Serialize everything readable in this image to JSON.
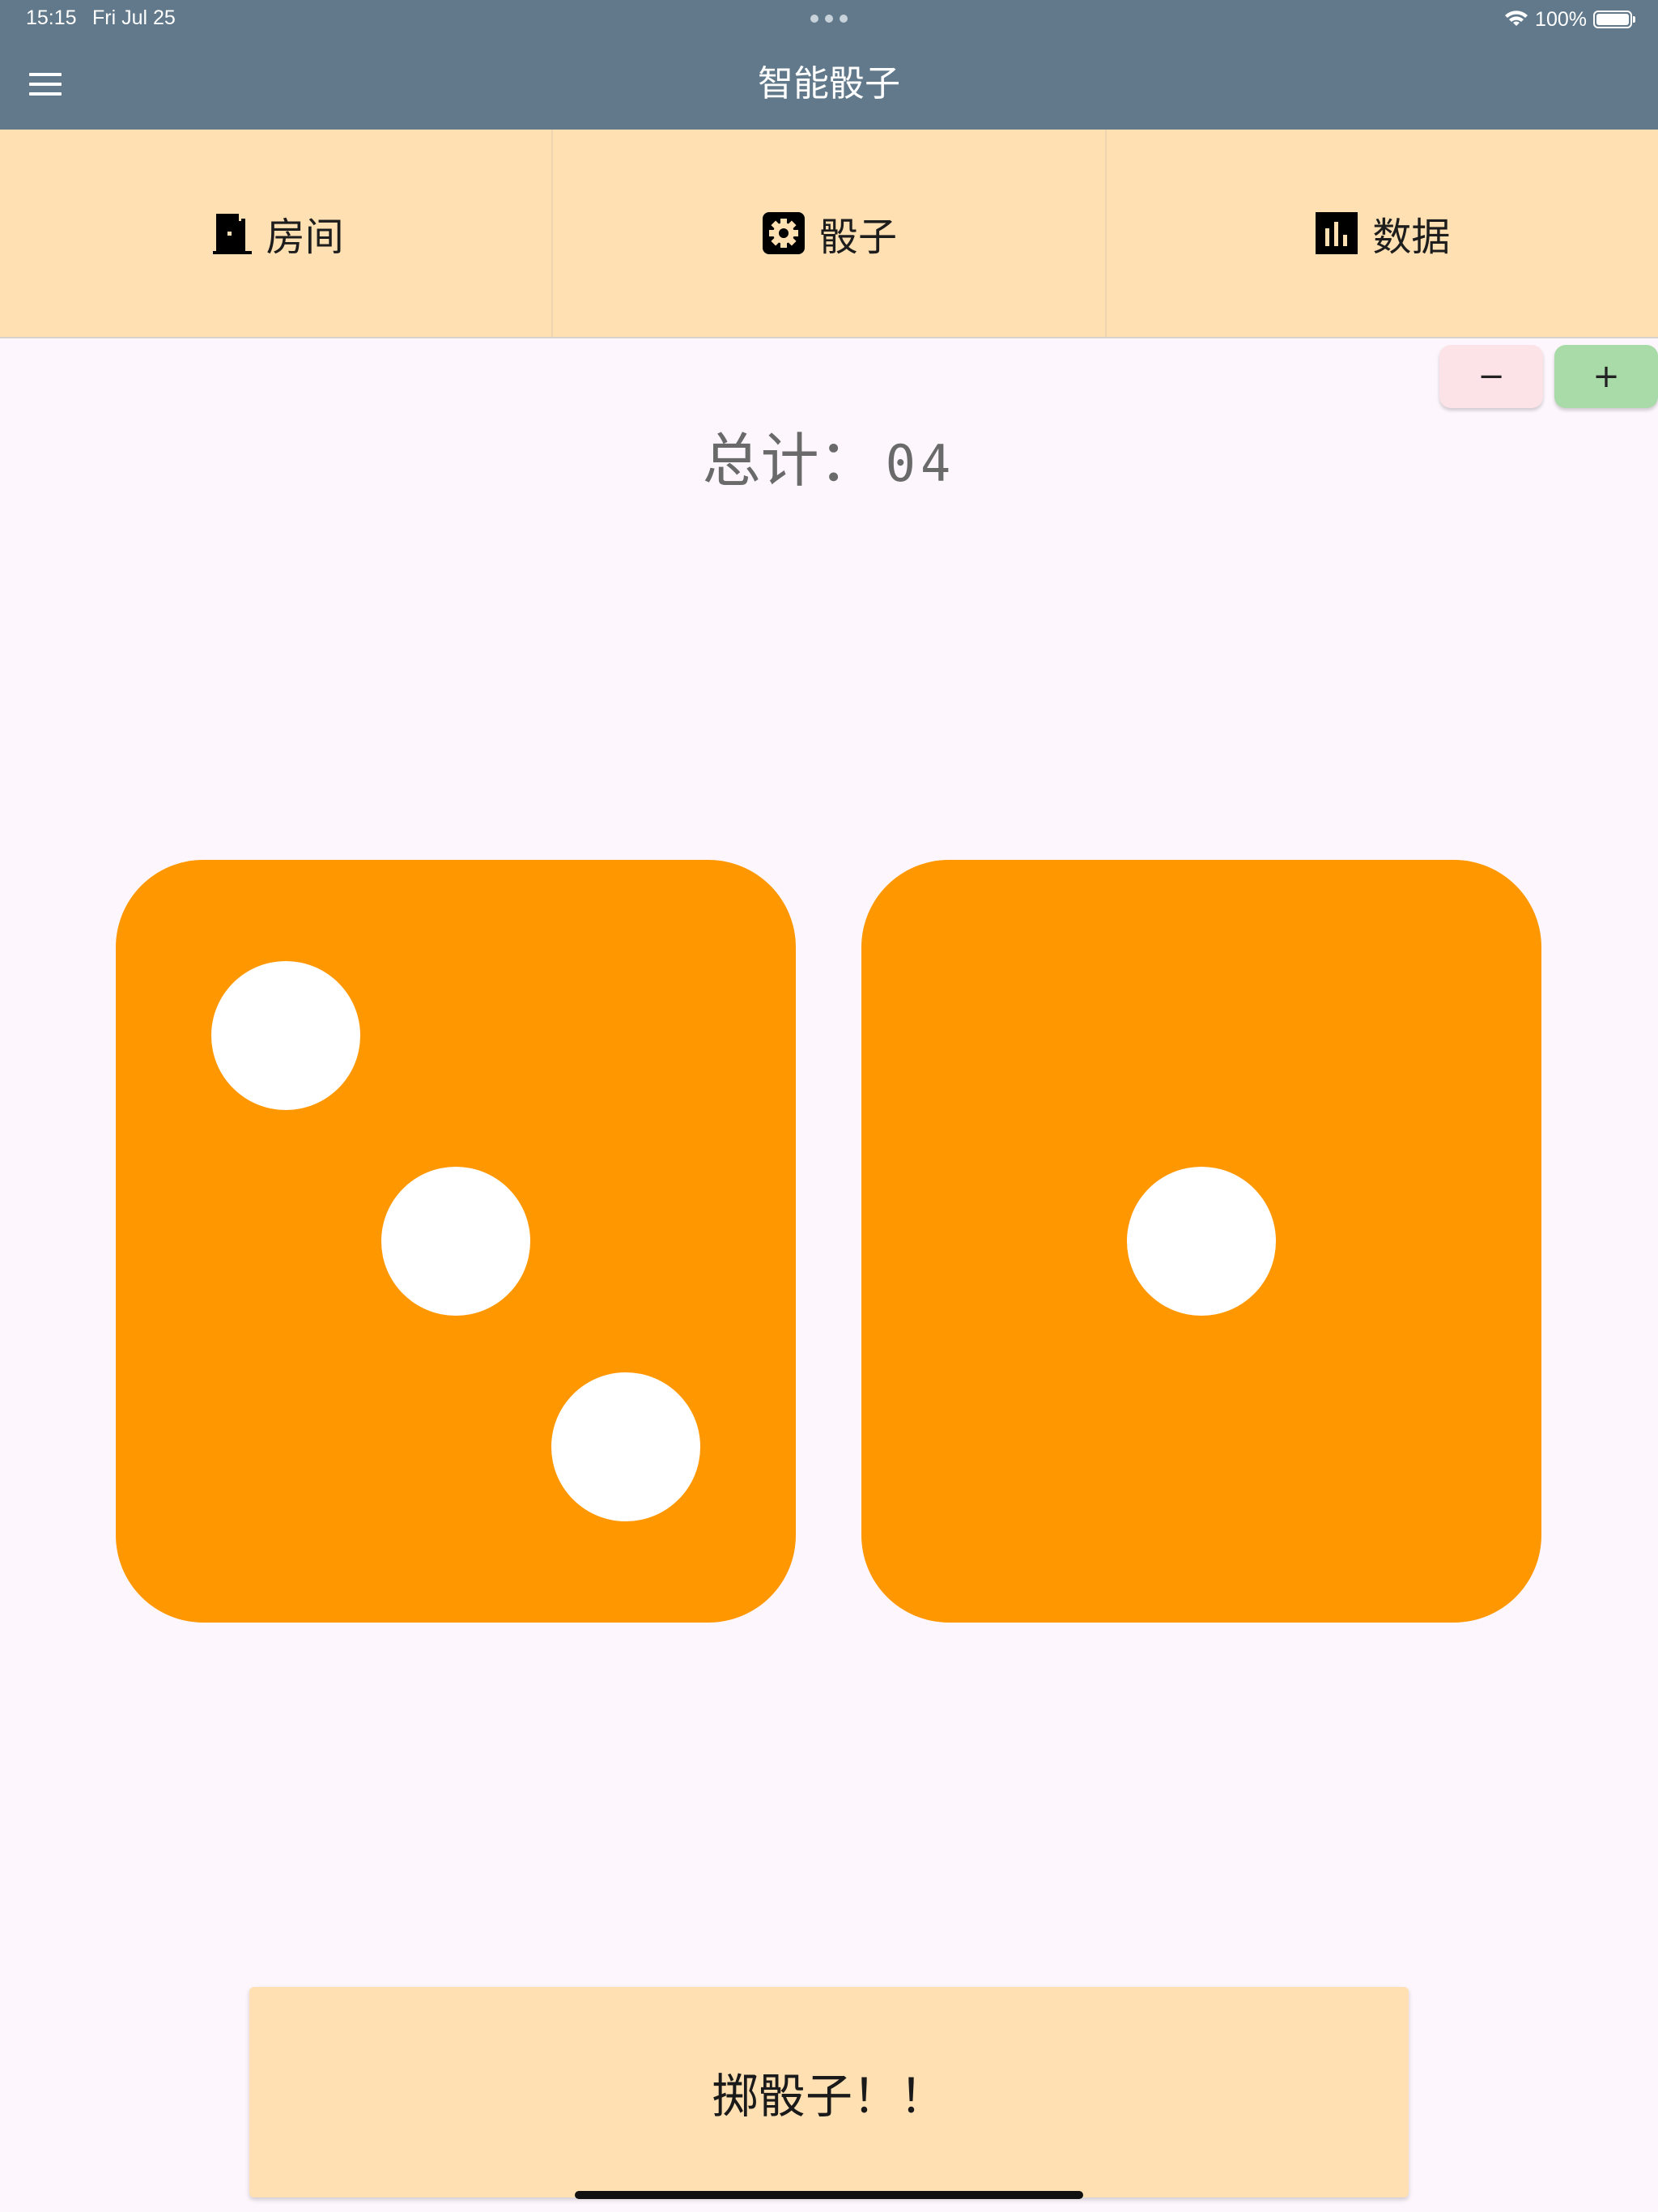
{
  "status_bar": {
    "time": "15:15",
    "date": "Fri Jul 25",
    "battery": "100%"
  },
  "app_bar": {
    "title": "智能骰子",
    "background": "#61798a"
  },
  "tabs": [
    {
      "label": "房间",
      "icon": "door-icon"
    },
    {
      "label": "骰子",
      "icon": "gear-icon"
    },
    {
      "label": "数据",
      "icon": "bar-chart-icon"
    }
  ],
  "counter": {
    "minus_label": "−",
    "plus_label": "+"
  },
  "total": {
    "label": "总计：",
    "value": "04"
  },
  "dice": [
    {
      "value": 3,
      "color": "#ff9800"
    },
    {
      "value": 1,
      "color": "#ff9800"
    }
  ],
  "roll_button": {
    "label": "掷骰子！！"
  },
  "colors": {
    "accent": "#ff9800",
    "tab_background": "#ffe0b2",
    "plus_button": "#a8dba8",
    "minus_button": "#fbe3e8",
    "page_background": "#fdf7fd"
  }
}
